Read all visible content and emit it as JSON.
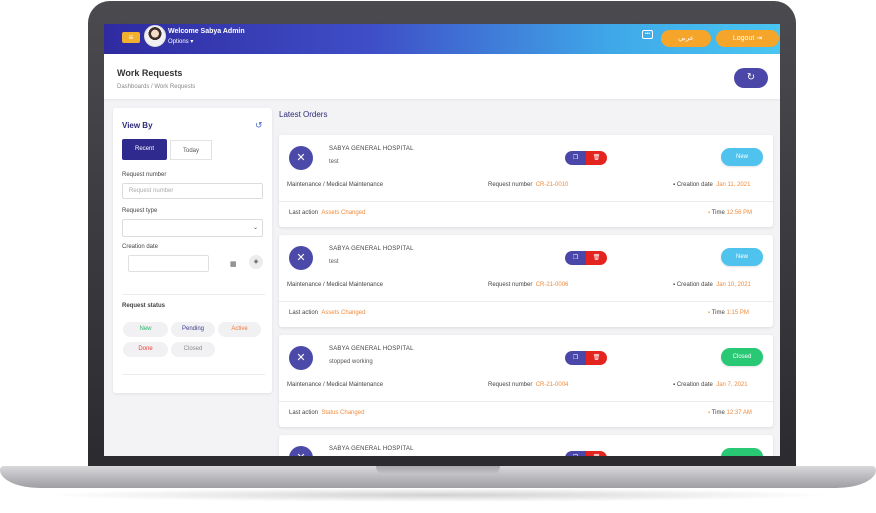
{
  "topbar": {
    "menu_icon": "hamburger-icon",
    "welcome": "Welcome Sabya Admin",
    "options": "Options ▾",
    "chat_icon": "chat-icon",
    "lang_button": "عربي",
    "logout_button": "Logout"
  },
  "header": {
    "title": "Work Requests",
    "breadcrumb": "Dashboards /   Work Requests"
  },
  "filter": {
    "view_by": "View By",
    "tab_recent": "Recent",
    "tab_today": "Today",
    "request_number_label": "Request number",
    "request_number_placeholder": "Request number",
    "request_type_label": "Request type",
    "creation_date_label": "Creation date",
    "status_label": "Request status",
    "statuses": [
      {
        "label": "New",
        "color": "#2db26a"
      },
      {
        "label": "Pending",
        "color": "#3a3a8a"
      },
      {
        "label": "Active",
        "color": "#f07a3a"
      },
      {
        "label": "Done",
        "color": "#e4433a"
      },
      {
        "label": "Closed",
        "color": "#8a8a8a"
      }
    ]
  },
  "orders": {
    "title": "Latest Orders",
    "items": [
      {
        "hospital": "SABYA GENERAL HOSPITAL",
        "description": "test",
        "category": "Maintenance / Medical Maintenance",
        "request_number_label": "Request number",
        "request_number": "CR-21-0010",
        "creation_date_label": "Creation date",
        "creation_date": "Jan 11, 2021",
        "last_action_label": "Last action",
        "last_action": "Assets Changed",
        "time_label": "Time",
        "time": "12:56 PM",
        "status": "New"
      },
      {
        "hospital": "SABYA GENERAL HOSPITAL",
        "description": "test",
        "category": "Maintenance / Medical Maintenance",
        "request_number_label": "Request number",
        "request_number": "CR-21-0006",
        "creation_date_label": "Creation date",
        "creation_date": "Jan 10, 2021",
        "last_action_label": "Last action",
        "last_action": "Assets Changed",
        "time_label": "Time",
        "time": "1:15 PM",
        "status": "New"
      },
      {
        "hospital": "SABYA GENERAL HOSPITAL",
        "description": "stopped working",
        "category": "Maintenance / Medical Maintenance",
        "request_number_label": "Request number",
        "request_number": "CR-21-0004",
        "creation_date_label": "Creation date",
        "creation_date": "Jan 7, 2021",
        "last_action_label": "Last action",
        "last_action": "Status Changed",
        "time_label": "Time",
        "time": "12:37 AM",
        "status": "Closed"
      },
      {
        "hospital": "SABYA GENERAL HOSPITAL"
      }
    ]
  },
  "colors": {
    "primary": "#2f2a8e",
    "accent": "#f5a52a",
    "new": "#4fc3ee",
    "closed": "#28c874",
    "delete": "#e4241f"
  }
}
